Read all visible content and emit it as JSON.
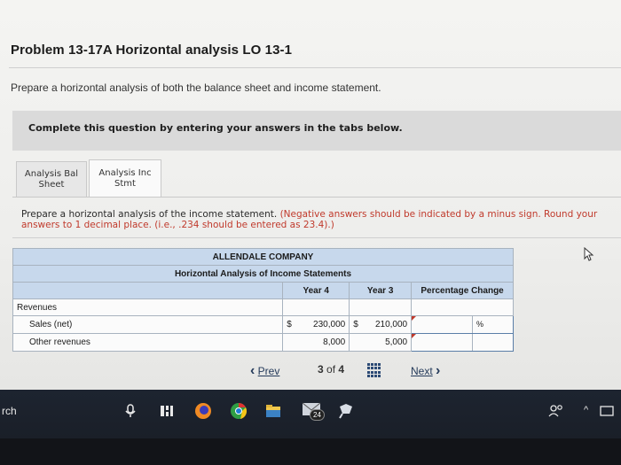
{
  "problem": {
    "title": "Problem 13-17A Horizontal analysis LO 13-1",
    "instruction": "Prepare a horizontal analysis of both the balance sheet and income statement."
  },
  "banner": {
    "text": "Complete this question by entering your answers in the tabs below."
  },
  "tabs": [
    {
      "label_line1": "Analysis Bal",
      "label_line2": "Sheet"
    },
    {
      "label_line1": "Analysis Inc",
      "label_line2": "Stmt"
    }
  ],
  "content": {
    "instruction_main": "Prepare a horizontal analysis of the income statement. ",
    "instruction_note": "(Negative answers should be indicated by a minus sign. Round your answers to 1 decimal place. (i.e., .234 should be entered as 23.4).)"
  },
  "table": {
    "company": "ALLENDALE COMPANY",
    "subtitle": "Horizontal Analysis of Income Statements",
    "col_year4": "Year 4",
    "col_year3": "Year 3",
    "col_pct": "Percentage Change",
    "section": "Revenues",
    "rows": [
      {
        "label": "Sales (net)",
        "sym4": "$",
        "year4": "230,000",
        "sym3": "$",
        "year3": "210,000",
        "pct_sign": "%"
      },
      {
        "label": "Other revenues",
        "sym4": "",
        "year4": "8,000",
        "sym3": "",
        "year3": "5,000",
        "pct_sign": ""
      }
    ]
  },
  "pager": {
    "prev_symbol": "‹",
    "prev_label": "Prev",
    "page_current": "3",
    "page_sep": "of",
    "page_total": "4",
    "next_label": "Next",
    "next_symbol": "›"
  },
  "taskbar": {
    "search_fragment": "rch",
    "badge_count": "24",
    "people_icon": "people-icon",
    "tray_caret": "^"
  }
}
